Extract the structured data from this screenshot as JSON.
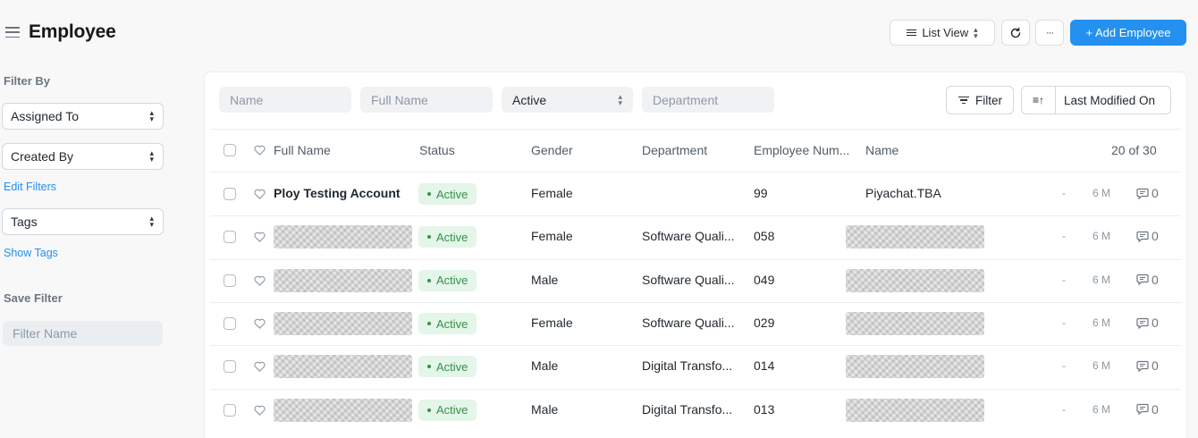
{
  "header": {
    "title": "Employee",
    "list_view_label": "List View",
    "more_label": "···",
    "add_label": "+ Add Employee"
  },
  "sidebar": {
    "filter_by": "Filter By",
    "assigned_to": "Assigned To",
    "created_by": "Created By",
    "edit_filters": "Edit Filters",
    "tags": "Tags",
    "show_tags": "Show Tags",
    "save_filter": "Save Filter",
    "filter_name_placeholder": "Filter Name"
  },
  "filters": {
    "name_placeholder": "Name",
    "full_name_placeholder": "Full Name",
    "status_value": "Active",
    "department_placeholder": "Department",
    "filter_label": "Filter",
    "sort_label": "Last Modified On"
  },
  "table": {
    "columns": [
      "Full Name",
      "Status",
      "Gender",
      "Department",
      "Employee Num...",
      "Name"
    ],
    "count": "20 of 30",
    "rows": [
      {
        "full_name": "Ploy Testing Account",
        "status": "Active",
        "gender": "Female",
        "department": "",
        "number": "99",
        "name": "Piyachat.TBA",
        "dash": "-",
        "modified": "6 M",
        "comments": "0"
      },
      {
        "full_name": "",
        "status": "Active",
        "gender": "Female",
        "department": "Software Quali...",
        "number": "058",
        "name": "",
        "dash": "-",
        "modified": "6 M",
        "comments": "0"
      },
      {
        "full_name": "",
        "status": "Active",
        "gender": "Male",
        "department": "Software Quali...",
        "number": "049",
        "name": "",
        "dash": "-",
        "modified": "6 M",
        "comments": "0"
      },
      {
        "full_name": "",
        "status": "Active",
        "gender": "Female",
        "department": "Software Quali...",
        "number": "029",
        "name": "",
        "dash": "-",
        "modified": "6 M",
        "comments": "0"
      },
      {
        "full_name": "",
        "status": "Active",
        "gender": "Male",
        "department": "Digital Transfo...",
        "number": "014",
        "name": "",
        "dash": "-",
        "modified": "6 M",
        "comments": "0"
      },
      {
        "full_name": "",
        "status": "Active",
        "gender": "Male",
        "department": "Digital Transfo...",
        "number": "013",
        "name": "",
        "dash": "-",
        "modified": "6 M",
        "comments": "0"
      }
    ]
  },
  "colors": {
    "primary": "#2490ef",
    "status_green": "#36914a",
    "status_green_bg": "#e4f5e9"
  }
}
